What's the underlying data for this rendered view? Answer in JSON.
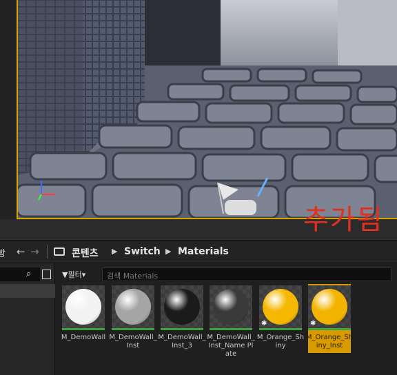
{
  "breadcrumb": {
    "partial_left": "방",
    "items": [
      "콘텐츠",
      "Switch",
      "Materials"
    ]
  },
  "filter": {
    "label": "필터",
    "search_placeholder": "검색 Materials"
  },
  "assets": [
    {
      "name": "M_DemoWall",
      "color": "#f2f2f2",
      "instance": false,
      "selected": false
    },
    {
      "name": "M_DemoWall_Inst",
      "color": "#a5a5a5",
      "instance": false,
      "selected": false
    },
    {
      "name": "M_DemoWall_Inst_3",
      "color": "#1b1b1b",
      "instance": false,
      "selected": false
    },
    {
      "name": "M_DemoWall_Inst_Name Plate",
      "color": "#3a3a3a",
      "instance": false,
      "selected": false
    },
    {
      "name": "M_Orange_Shiny",
      "color": "#f5b800",
      "instance": true,
      "selected": false
    },
    {
      "name": "M_Orange_Shiny_Inst",
      "color": "#f3b400",
      "instance": true,
      "selected": true
    }
  ],
  "annotation": {
    "text": "추가됨",
    "color": "#e0301e"
  },
  "colors": {
    "selection": "#d99a00",
    "viewport_border": "#d8a400",
    "saved_bar": "#3da33d"
  }
}
